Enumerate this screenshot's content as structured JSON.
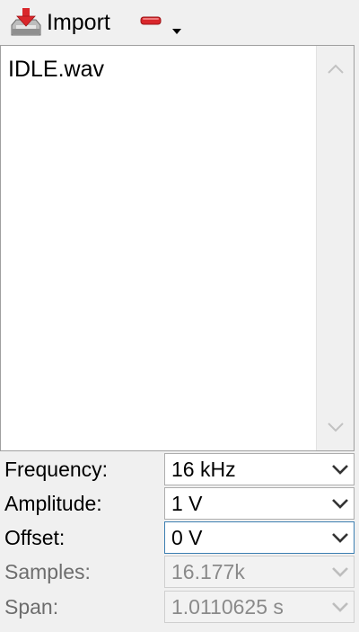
{
  "toolbar": {
    "import_label": "Import",
    "import_icon": "import-tray-icon",
    "remove_icon": "minus-icon",
    "dropdown_icon": "triangle-down-icon"
  },
  "file_list": {
    "items": [
      "IDLE.wav"
    ]
  },
  "properties": [
    {
      "label": "Frequency:",
      "value": "16 kHz",
      "enabled": true
    },
    {
      "label": "Amplitude:",
      "value": "1 V",
      "enabled": true
    },
    {
      "label": "Offset:",
      "value": "0 V",
      "enabled": true,
      "focused": true
    },
    {
      "label": "Samples:",
      "value": "16.177k",
      "enabled": false
    },
    {
      "label": "Span:",
      "value": "1.0110625 s",
      "enabled": false
    }
  ],
  "colors": {
    "accent_red": "#d9262b",
    "focus_border": "#3c7fb1",
    "disabled_text": "#8a8a8a"
  }
}
